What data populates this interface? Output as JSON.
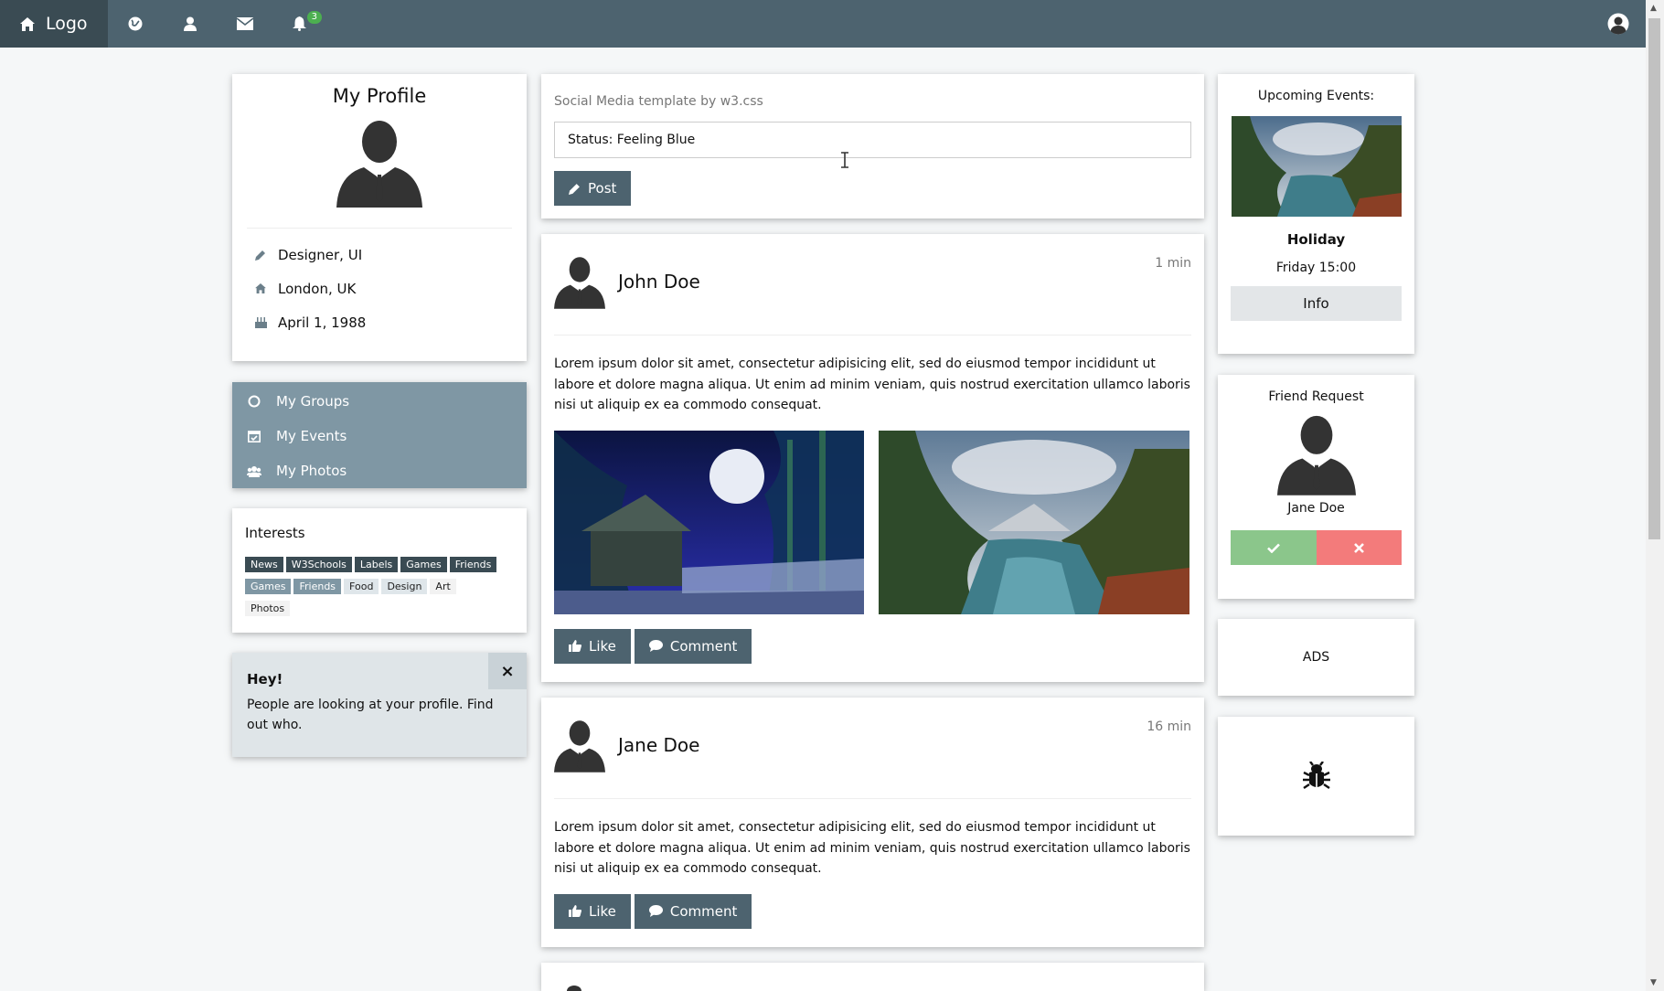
{
  "topbar": {
    "logo_label": "Logo",
    "badge_count": "3",
    "icons": [
      "home-icon",
      "globe-icon",
      "user-icon",
      "envelope-icon",
      "bell-icon",
      "account-icon"
    ]
  },
  "profile": {
    "title": "My Profile",
    "job": "Designer, UI",
    "location": "London, UK",
    "birthday": "April 1, 1988"
  },
  "menu": {
    "groups": "My Groups",
    "events": "My Events",
    "photos": "My Photos"
  },
  "interests": {
    "title": "Interests",
    "tags": [
      "News",
      "W3Schools",
      "Labels",
      "Games",
      "Friends",
      "Games",
      "Friends",
      "Food",
      "Design",
      "Art",
      "Photos"
    ]
  },
  "alert": {
    "title": "Hey!",
    "message": "People are looking at your profile. Find out who.",
    "close": "×"
  },
  "composer": {
    "caption": "Social Media template by w3.css",
    "status_value": "Status: Feeling Blue",
    "post_label": "Post"
  },
  "posts": [
    {
      "author": "John Doe",
      "time": "1 min",
      "text": "Lorem ipsum dolor sit amet, consectetur adipisicing elit, sed do eiusmod tempor incididunt ut labore et dolore magna aliqua. Ut enim ad minim veniam, quis nostrud exercitation ullamco laboris nisi ut aliquip ex ea commodo consequat.",
      "like": "Like",
      "comment": "Comment"
    },
    {
      "author": "Jane Doe",
      "time": "16 min",
      "text": "Lorem ipsum dolor sit amet, consectetur adipisicing elit, sed do eiusmod tempor incididunt ut labore et dolore magna aliqua. Ut enim ad minim veniam, quis nostrud exercitation ullamco laboris nisi ut aliquip ex ea commodo consequat.",
      "like": "Like",
      "comment": "Comment"
    }
  ],
  "events": {
    "title": "Upcoming Events:",
    "name": "Holiday",
    "time": "Friday 15:00",
    "info_label": "Info"
  },
  "friend_request": {
    "title": "Friend Request",
    "name": "Jane Doe",
    "accept_icon": "check-icon",
    "decline_icon": "close-icon"
  },
  "ads": {
    "label": "ADS"
  },
  "bug": {
    "icon": "bug-icon"
  },
  "colors": {
    "theme_d1": "#3a4b53",
    "theme_d2": "#4d636f",
    "theme_l1": "#7f97a4",
    "accept": "#8bc68b",
    "decline": "#f37b7b"
  }
}
